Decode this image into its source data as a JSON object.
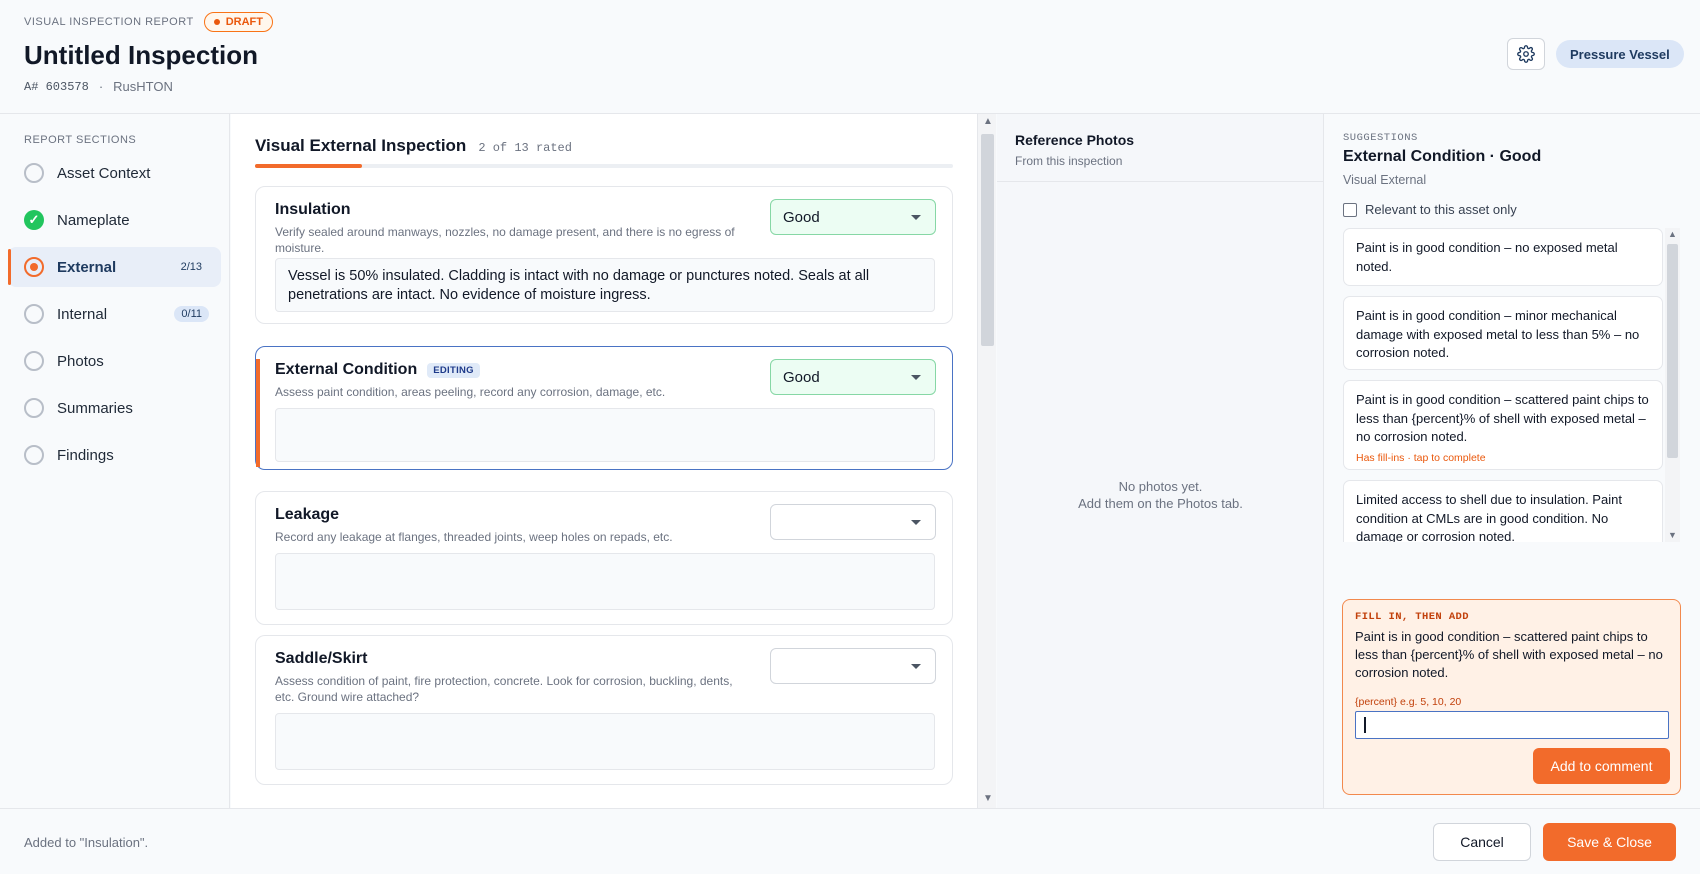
{
  "header": {
    "kicker": "VISUAL INSPECTION REPORT",
    "status_badge": "DRAFT",
    "title": "Untitled Inspection",
    "asset_number": "A# 603578",
    "separator": "·",
    "location": "RusHTON",
    "asset_type": "Pressure Vessel"
  },
  "sidebar": {
    "heading": "REPORT SECTIONS",
    "items": [
      {
        "label": "Asset Context",
        "state": "empty",
        "count": ""
      },
      {
        "label": "Nameplate",
        "state": "done",
        "count": ""
      },
      {
        "label": "External",
        "state": "current",
        "count": "2/13"
      },
      {
        "label": "Internal",
        "state": "empty",
        "count": "0/11"
      },
      {
        "label": "Photos",
        "state": "empty",
        "count": ""
      },
      {
        "label": "Summaries",
        "state": "empty",
        "count": ""
      },
      {
        "label": "Findings",
        "state": "empty",
        "count": ""
      }
    ],
    "done_glyph": "✓"
  },
  "main": {
    "section_title": "Visual External Inspection",
    "rated_text": "2 of 13 rated",
    "progress": 0.154,
    "editing_tag": "EDITING",
    "items": [
      {
        "name": "Insulation",
        "description": "Verify sealed around manways, nozzles, no damage present, and there is no egress of moisture.",
        "rating": "Good",
        "comment": "Vessel is 50% insulated. Cladding is intact with no damage or punctures noted. Seals at all penetrations are intact. No evidence of moisture ingress."
      },
      {
        "name": "External Condition",
        "description": "Assess paint condition, areas peeling, record any corrosion, damage, etc.",
        "rating": "Good",
        "comment": ""
      },
      {
        "name": "Leakage",
        "description": "Record any leakage at flanges, threaded joints, weep holes on repads, etc.",
        "rating": "",
        "comment": ""
      },
      {
        "name": "Saddle/Skirt",
        "description": "Assess condition of paint, fire protection, concrete. Look for corrosion, buckling, dents, etc. Ground wire attached?",
        "rating": "",
        "comment": ""
      }
    ]
  },
  "photos": {
    "title": "Reference Photos",
    "subtitle": "From this inspection",
    "empty_line1": "No photos yet.",
    "empty_line2": "Add them on the Photos tab."
  },
  "suggestions": {
    "kicker": "SUGGESTIONS",
    "title": "External Condition · Good",
    "subtitle": "Visual External",
    "relevant_label": "Relevant to this asset only",
    "relevant_checked": false,
    "items": [
      {
        "text": "Paint is in good condition – no exposed metal noted.",
        "hint": ""
      },
      {
        "text": "Paint is in good condition – minor mechanical damage with exposed metal to less than 5% – no corrosion noted.",
        "hint": ""
      },
      {
        "text": "Paint is in good condition – scattered paint chips to less than {percent}% of shell with exposed metal – no corrosion noted.",
        "hint": "Has fill-ins ·  tap to complete"
      },
      {
        "text": "Limited access to shell due to insulation. Paint condition at CMLs are in good condition. No damage or corrosion noted.",
        "hint": ""
      }
    ],
    "fill_panel": {
      "kicker": "FILL IN, THEN ADD",
      "text": "Paint is in good condition – scattered paint chips to less than {percent}% of shell with exposed metal – no corrosion noted.",
      "field_label": "{percent}   e.g. 5, 10, 20",
      "field_value": "",
      "button": "Add to comment"
    }
  },
  "footer": {
    "status": "Added to \"Insulation\".",
    "cancel": "Cancel",
    "save": "Save & Close"
  },
  "colors": {
    "accent": "#f26b2b",
    "good_bg": "#ecfdf3",
    "editing_border": "#4a73c4",
    "done": "#22c55e"
  }
}
